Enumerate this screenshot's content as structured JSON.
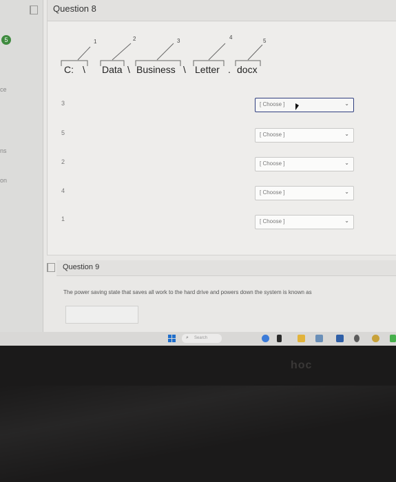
{
  "left_nav": {
    "badge": "5",
    "texts": [
      "ce",
      "ns",
      "on"
    ]
  },
  "question8": {
    "title": "Question 8",
    "path_parts": [
      "C:",
      "\\",
      "Data",
      "\\",
      "Business",
      "\\",
      "Letter",
      ".",
      "docx"
    ],
    "part_numbers": [
      "1",
      "2",
      "3",
      "4",
      "5"
    ],
    "rows": [
      {
        "number": "3",
        "select": "[ Choose ]"
      },
      {
        "number": "5",
        "select": "[ Choose ]"
      },
      {
        "number": "2",
        "select": "[ Choose ]"
      },
      {
        "number": "4",
        "select": "[ Choose ]"
      },
      {
        "number": "1",
        "select": "[ Choose ]"
      }
    ],
    "chevron": "⌄"
  },
  "question9": {
    "title": "Question 9",
    "text": "The power saving state that saves all work to the hard drive and powers down the system is known as",
    "answer": ""
  },
  "taskbar": {
    "search_placeholder": "Search",
    "search_icon": "search-icon",
    "accent": "#1f6ecb"
  },
  "bezel_text": "hoc"
}
